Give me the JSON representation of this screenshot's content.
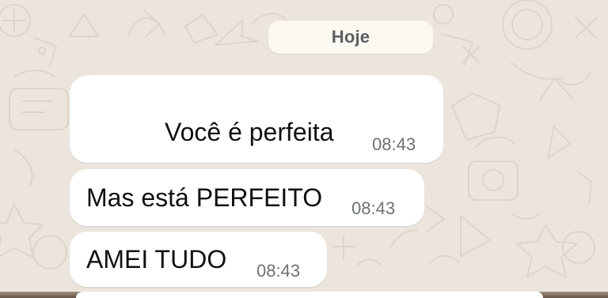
{
  "chat": {
    "date_label": "Hoje",
    "messages": [
      {
        "text": "Você é perfeita",
        "time": "08:43"
      },
      {
        "text": "Mas está PERFEITO",
        "time": "08:43"
      },
      {
        "text": "AMEI TUDO",
        "time": "08:43"
      }
    ]
  },
  "colors": {
    "wallpaper": "#ece5dd",
    "bubble": "#ffffff",
    "date_chip": "#fbf8f2",
    "time_text": "#6d7275"
  }
}
